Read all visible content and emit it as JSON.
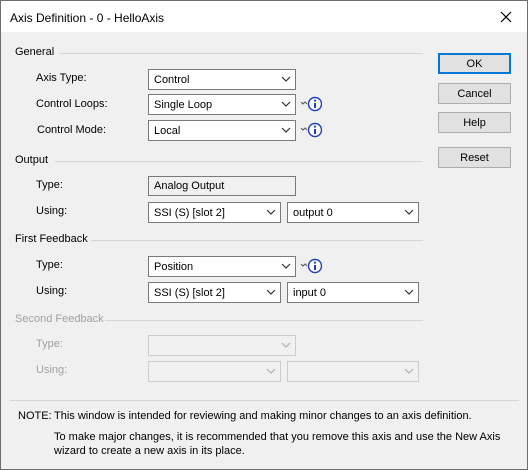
{
  "window": {
    "title": "Axis Definition - 0 - HelloAxis"
  },
  "buttons": {
    "ok": "OK",
    "cancel": "Cancel",
    "help": "Help",
    "reset": "Reset"
  },
  "general": {
    "header": "General",
    "axis_type_label": "Axis Type:",
    "axis_type_value": "Control",
    "control_loops_label": "Control Loops:",
    "control_loops_value": "Single Loop",
    "control_mode_label": "Control Mode:",
    "control_mode_value": "Local"
  },
  "output": {
    "header": "Output",
    "type_label": "Type:",
    "type_value": "Analog Output",
    "using_label": "Using:",
    "using_value": "SSI (S) [slot 2]",
    "channel_value": "output 0"
  },
  "first_feedback": {
    "header": "First Feedback",
    "type_label": "Type:",
    "type_value": "Position",
    "using_label": "Using:",
    "using_value": "SSI (S) [slot 2]",
    "channel_value": "input 0"
  },
  "second_feedback": {
    "header": "Second Feedback",
    "type_label": "Type:",
    "using_label": "Using:"
  },
  "note": {
    "prefix": "NOTE:",
    "line1": "This window is intended for reviewing and making minor changes to an axis definition.",
    "line2": "To make major changes, it is recommended that you remove this axis and use the New Axis",
    "line3": "wizard to create a new axis in its place."
  },
  "colors": {
    "info_blue": "#1f3fbf",
    "default_focus": "#0078d7",
    "disabled_text": "#a0a0a0"
  },
  "icons": {
    "info": "info-icon",
    "close": "close-icon",
    "dropdown": "chevron-down-icon"
  }
}
